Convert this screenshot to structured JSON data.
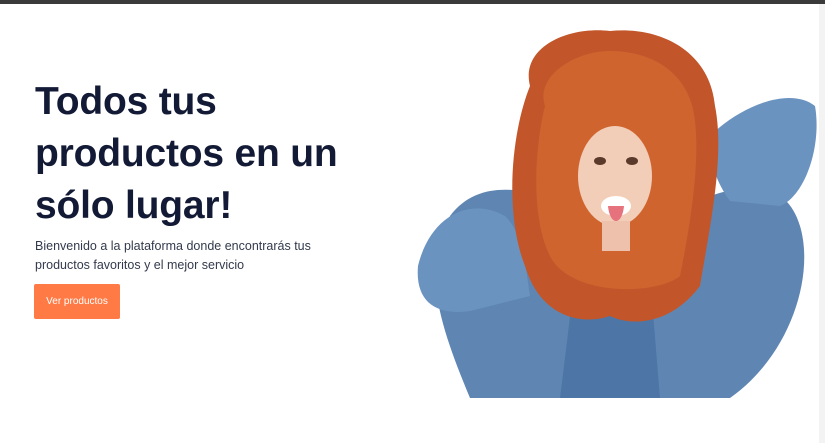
{
  "hero": {
    "title": "Todos tus productos en un sólo lugar!",
    "subtitle": "Bienvenido a la plataforma donde encontrarás tus productos favoritos y el mejor servicio",
    "cta_label": "Ver productos",
    "photo_icon": "hero-woman-photo"
  },
  "colors": {
    "accent": "#ff7a45",
    "heading": "#131a35",
    "background": "#ffffff"
  }
}
